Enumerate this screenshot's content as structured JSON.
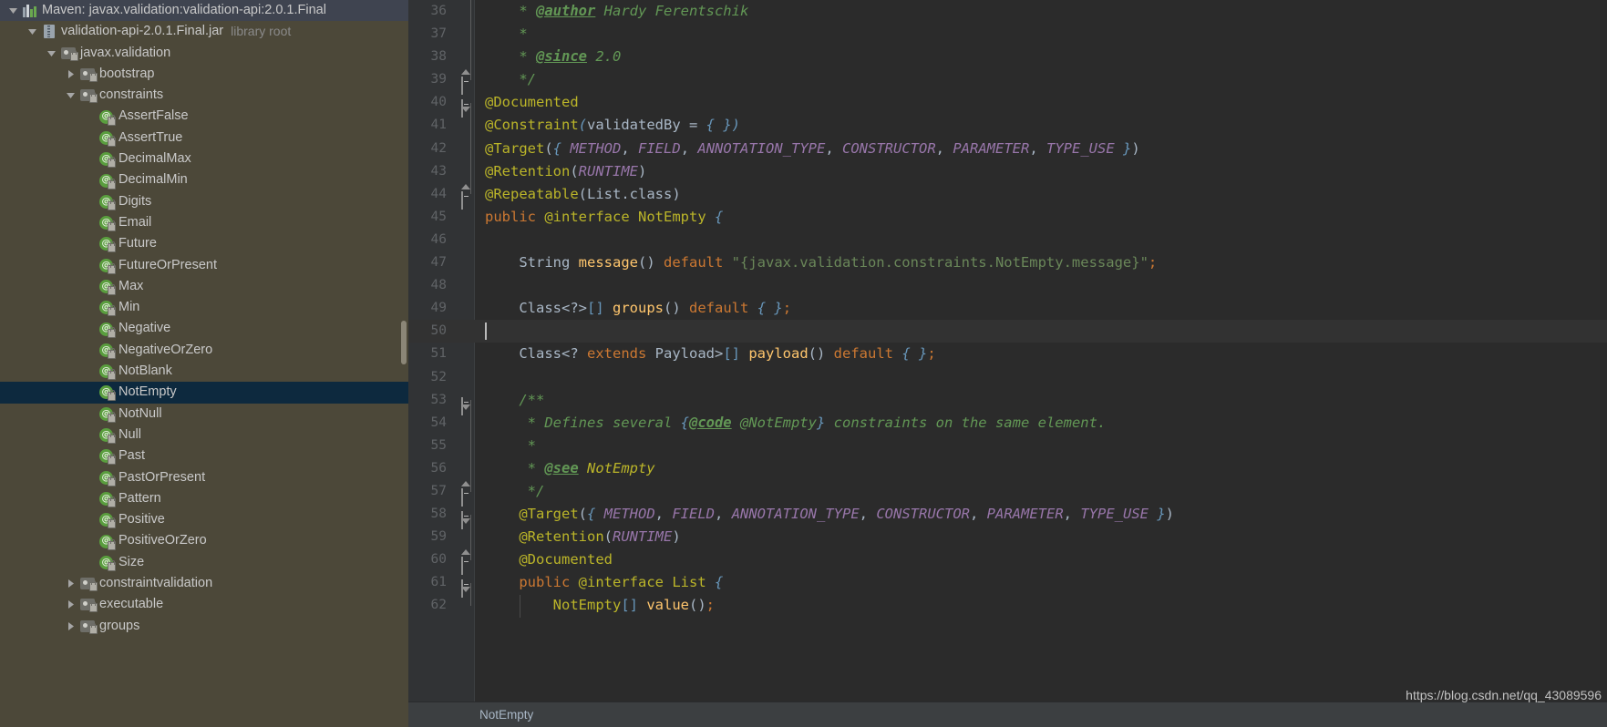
{
  "theme": {
    "tree_bg": "#4c4839",
    "tree_root_bg": "#3f4450",
    "tree_selected_bg": "#0d293e",
    "editor_bg": "#2b2b2b",
    "gutter_bg": "#313335",
    "current_line_bg": "#323232",
    "keyword": "#cc7832",
    "annotation": "#bbb529",
    "method": "#ffc66d",
    "string": "#6a8759",
    "comment": "#629755",
    "static_field": "#9876aa",
    "bracket": "#6897bb",
    "text": "#a9b7c6"
  },
  "project_tree": {
    "name": "project-library-tree",
    "items": [
      {
        "label": "Maven: javax.validation:validation-api:2.0.1.Final",
        "sub": "",
        "depth": 0,
        "icon": "maven-icon",
        "twisty": "expanded",
        "state": "root"
      },
      {
        "label": "validation-api-2.0.1.Final.jar",
        "sub": "library root",
        "depth": 1,
        "icon": "jar-icon",
        "twisty": "expanded",
        "state": "normal"
      },
      {
        "label": "javax.validation",
        "sub": "",
        "depth": 2,
        "icon": "package-icon",
        "twisty": "expanded",
        "state": "normal"
      },
      {
        "label": "bootstrap",
        "sub": "",
        "depth": 3,
        "icon": "package-icon",
        "twisty": "collapsed",
        "state": "normal"
      },
      {
        "label": "constraints",
        "sub": "",
        "depth": 3,
        "icon": "package-icon",
        "twisty": "expanded",
        "state": "normal"
      },
      {
        "label": "AssertFalse",
        "sub": "",
        "depth": 4,
        "icon": "annotation-icon",
        "twisty": "none",
        "state": "normal"
      },
      {
        "label": "AssertTrue",
        "sub": "",
        "depth": 4,
        "icon": "annotation-icon",
        "twisty": "none",
        "state": "normal"
      },
      {
        "label": "DecimalMax",
        "sub": "",
        "depth": 4,
        "icon": "annotation-icon",
        "twisty": "none",
        "state": "normal"
      },
      {
        "label": "DecimalMin",
        "sub": "",
        "depth": 4,
        "icon": "annotation-icon",
        "twisty": "none",
        "state": "normal"
      },
      {
        "label": "Digits",
        "sub": "",
        "depth": 4,
        "icon": "annotation-icon",
        "twisty": "none",
        "state": "normal"
      },
      {
        "label": "Email",
        "sub": "",
        "depth": 4,
        "icon": "annotation-icon",
        "twisty": "none",
        "state": "normal"
      },
      {
        "label": "Future",
        "sub": "",
        "depth": 4,
        "icon": "annotation-icon",
        "twisty": "none",
        "state": "normal"
      },
      {
        "label": "FutureOrPresent",
        "sub": "",
        "depth": 4,
        "icon": "annotation-icon",
        "twisty": "none",
        "state": "normal"
      },
      {
        "label": "Max",
        "sub": "",
        "depth": 4,
        "icon": "annotation-icon",
        "twisty": "none",
        "state": "normal"
      },
      {
        "label": "Min",
        "sub": "",
        "depth": 4,
        "icon": "annotation-icon",
        "twisty": "none",
        "state": "normal"
      },
      {
        "label": "Negative",
        "sub": "",
        "depth": 4,
        "icon": "annotation-icon",
        "twisty": "none",
        "state": "normal"
      },
      {
        "label": "NegativeOrZero",
        "sub": "",
        "depth": 4,
        "icon": "annotation-icon",
        "twisty": "none",
        "state": "normal"
      },
      {
        "label": "NotBlank",
        "sub": "",
        "depth": 4,
        "icon": "annotation-icon",
        "twisty": "none",
        "state": "normal"
      },
      {
        "label": "NotEmpty",
        "sub": "",
        "depth": 4,
        "icon": "annotation-icon",
        "twisty": "none",
        "state": "selected"
      },
      {
        "label": "NotNull",
        "sub": "",
        "depth": 4,
        "icon": "annotation-icon",
        "twisty": "none",
        "state": "normal"
      },
      {
        "label": "Null",
        "sub": "",
        "depth": 4,
        "icon": "annotation-icon",
        "twisty": "none",
        "state": "normal"
      },
      {
        "label": "Past",
        "sub": "",
        "depth": 4,
        "icon": "annotation-icon",
        "twisty": "none",
        "state": "normal"
      },
      {
        "label": "PastOrPresent",
        "sub": "",
        "depth": 4,
        "icon": "annotation-icon",
        "twisty": "none",
        "state": "normal"
      },
      {
        "label": "Pattern",
        "sub": "",
        "depth": 4,
        "icon": "annotation-icon",
        "twisty": "none",
        "state": "normal"
      },
      {
        "label": "Positive",
        "sub": "",
        "depth": 4,
        "icon": "annotation-icon",
        "twisty": "none",
        "state": "normal"
      },
      {
        "label": "PositiveOrZero",
        "sub": "",
        "depth": 4,
        "icon": "annotation-icon",
        "twisty": "none",
        "state": "normal"
      },
      {
        "label": "Size",
        "sub": "",
        "depth": 4,
        "icon": "annotation-icon",
        "twisty": "none",
        "state": "normal"
      },
      {
        "label": "constraintvalidation",
        "sub": "",
        "depth": 3,
        "icon": "package-icon",
        "twisty": "collapsed",
        "state": "normal"
      },
      {
        "label": "executable",
        "sub": "",
        "depth": 3,
        "icon": "package-icon",
        "twisty": "collapsed",
        "state": "normal"
      },
      {
        "label": "groups",
        "sub": "",
        "depth": 3,
        "icon": "package-icon",
        "twisty": "collapsed",
        "state": "normal"
      }
    ]
  },
  "editor": {
    "name": "java-source-editor",
    "first_line_number": 36,
    "current_line": 50,
    "lines": [
      {
        "n": 36,
        "fold": "none",
        "tokens": [
          {
            "t": "cmt",
            "s": "    * "
          },
          {
            "t": "tag",
            "s": "@author"
          },
          {
            "t": "cmt",
            "s": " Hardy Ferentschik"
          }
        ]
      },
      {
        "n": 37,
        "fold": "none",
        "tokens": [
          {
            "t": "cmt",
            "s": "    *"
          }
        ]
      },
      {
        "n": 38,
        "fold": "none",
        "tokens": [
          {
            "t": "cmt",
            "s": "    * "
          },
          {
            "t": "tag",
            "s": "@since"
          },
          {
            "t": "cmt",
            "s": " 2.0"
          }
        ]
      },
      {
        "n": 39,
        "fold": "end",
        "tokens": [
          {
            "t": "cmt",
            "s": "    */"
          }
        ]
      },
      {
        "n": 40,
        "fold": "start",
        "tokens": [
          {
            "t": "anno",
            "s": "@Documented"
          }
        ]
      },
      {
        "n": 41,
        "fold": "none",
        "tokens": [
          {
            "t": "anno",
            "s": "@Constraint"
          },
          {
            "t": "brace-c",
            "s": "("
          },
          {
            "t": "ident",
            "s": "validatedBy"
          },
          {
            "t": "ident",
            "s": " = "
          },
          {
            "t": "brace-c",
            "s": "{ }"
          },
          {
            "t": "brace-c",
            "s": ")"
          }
        ]
      },
      {
        "n": 42,
        "fold": "none",
        "tokens": [
          {
            "t": "anno",
            "s": "@Target"
          },
          {
            "t": "paren",
            "s": "("
          },
          {
            "t": "brace-c",
            "s": "{ "
          },
          {
            "t": "sfield",
            "s": "METHOD"
          },
          {
            "t": "ident",
            "s": ", "
          },
          {
            "t": "sfield",
            "s": "FIELD"
          },
          {
            "t": "ident",
            "s": ", "
          },
          {
            "t": "sfield",
            "s": "ANNOTATION_TYPE"
          },
          {
            "t": "ident",
            "s": ", "
          },
          {
            "t": "sfield",
            "s": "CONSTRUCTOR"
          },
          {
            "t": "ident",
            "s": ", "
          },
          {
            "t": "sfield",
            "s": "PARAMETER"
          },
          {
            "t": "ident",
            "s": ", "
          },
          {
            "t": "sfield",
            "s": "TYPE_USE"
          },
          {
            "t": "brace-c",
            "s": " }"
          },
          {
            "t": "paren",
            "s": ")"
          }
        ]
      },
      {
        "n": 43,
        "fold": "none",
        "tokens": [
          {
            "t": "anno",
            "s": "@Retention"
          },
          {
            "t": "paren",
            "s": "("
          },
          {
            "t": "sfield",
            "s": "RUNTIME"
          },
          {
            "t": "paren",
            "s": ")"
          }
        ]
      },
      {
        "n": 44,
        "fold": "end",
        "tokens": [
          {
            "t": "anno",
            "s": "@Repeatable"
          },
          {
            "t": "paren",
            "s": "("
          },
          {
            "t": "ident",
            "s": "List.class"
          },
          {
            "t": "paren",
            "s": ")"
          }
        ]
      },
      {
        "n": 45,
        "fold": "none",
        "tokens": [
          {
            "t": "kw",
            "s": "public"
          },
          {
            "t": "ident",
            "s": " "
          },
          {
            "t": "anno",
            "s": "@interface"
          },
          {
            "t": "ident",
            "s": " "
          },
          {
            "t": "olive",
            "s": "NotEmpty"
          },
          {
            "t": "ident",
            "s": " "
          },
          {
            "t": "brace-c",
            "s": "{"
          }
        ]
      },
      {
        "n": 46,
        "fold": "none",
        "tokens": []
      },
      {
        "n": 47,
        "fold": "none",
        "tokens": [
          {
            "t": "type",
            "s": "    String "
          },
          {
            "t": "method",
            "s": "message"
          },
          {
            "t": "paren",
            "s": "()"
          },
          {
            "t": "kw",
            "s": " default "
          },
          {
            "t": "str",
            "s": "\"{javax.validation.constraints.NotEmpty.message}\""
          },
          {
            "t": "semi",
            "s": ";"
          }
        ]
      },
      {
        "n": 48,
        "fold": "none",
        "tokens": []
      },
      {
        "n": 49,
        "fold": "none",
        "tokens": [
          {
            "t": "type",
            "s": "    Class"
          },
          {
            "t": "paren",
            "s": "<?>"
          },
          {
            "t": "brk",
            "s": "[]"
          },
          {
            "t": "ident",
            "s": " "
          },
          {
            "t": "method",
            "s": "groups"
          },
          {
            "t": "paren",
            "s": "()"
          },
          {
            "t": "kw",
            "s": " default "
          },
          {
            "t": "brace-c",
            "s": "{ }"
          },
          {
            "t": "semi",
            "s": ";"
          }
        ]
      },
      {
        "n": 50,
        "fold": "none",
        "tokens": []
      },
      {
        "n": 51,
        "fold": "none",
        "tokens": [
          {
            "t": "type",
            "s": "    Class"
          },
          {
            "t": "paren",
            "s": "<? "
          },
          {
            "t": "kw",
            "s": "extends"
          },
          {
            "t": "type",
            "s": " Payload"
          },
          {
            "t": "paren",
            "s": ">"
          },
          {
            "t": "brk",
            "s": "[]"
          },
          {
            "t": "ident",
            "s": " "
          },
          {
            "t": "method",
            "s": "payload"
          },
          {
            "t": "paren",
            "s": "()"
          },
          {
            "t": "kw",
            "s": " default "
          },
          {
            "t": "brace-c",
            "s": "{ }"
          },
          {
            "t": "semi",
            "s": ";"
          }
        ]
      },
      {
        "n": 52,
        "fold": "none",
        "tokens": []
      },
      {
        "n": 53,
        "fold": "start",
        "tokens": [
          {
            "t": "cmt",
            "s": "    /**"
          }
        ]
      },
      {
        "n": 54,
        "fold": "none",
        "tokens": [
          {
            "t": "cmt",
            "s": "     * Defines several "
          },
          {
            "t": "brace-c",
            "s": "{"
          },
          {
            "t": "codetag",
            "s": "@code"
          },
          {
            "t": "cmt",
            "s": " @NotEmpty"
          },
          {
            "t": "brace-c",
            "s": "}"
          },
          {
            "t": "cmt",
            "s": " constraints on the same element."
          }
        ]
      },
      {
        "n": 55,
        "fold": "none",
        "tokens": [
          {
            "t": "cmt",
            "s": "     *"
          }
        ]
      },
      {
        "n": 56,
        "fold": "none",
        "tokens": [
          {
            "t": "cmt",
            "s": "     * "
          },
          {
            "t": "tag",
            "s": "@see"
          },
          {
            "t": "javadoc-ref",
            "s": " NotEmpty"
          }
        ]
      },
      {
        "n": 57,
        "fold": "end",
        "tokens": [
          {
            "t": "cmt",
            "s": "     */"
          }
        ]
      },
      {
        "n": 58,
        "fold": "start",
        "tokens": [
          {
            "t": "anno",
            "s": "    @Target"
          },
          {
            "t": "paren",
            "s": "("
          },
          {
            "t": "brace-c",
            "s": "{ "
          },
          {
            "t": "sfield",
            "s": "METHOD"
          },
          {
            "t": "ident",
            "s": ", "
          },
          {
            "t": "sfield",
            "s": "FIELD"
          },
          {
            "t": "ident",
            "s": ", "
          },
          {
            "t": "sfield",
            "s": "ANNOTATION_TYPE"
          },
          {
            "t": "ident",
            "s": ", "
          },
          {
            "t": "sfield",
            "s": "CONSTRUCTOR"
          },
          {
            "t": "ident",
            "s": ", "
          },
          {
            "t": "sfield",
            "s": "PARAMETER"
          },
          {
            "t": "ident",
            "s": ", "
          },
          {
            "t": "sfield",
            "s": "TYPE_USE"
          },
          {
            "t": "brace-c",
            "s": " }"
          },
          {
            "t": "paren",
            "s": ")"
          }
        ]
      },
      {
        "n": 59,
        "fold": "none",
        "tokens": [
          {
            "t": "anno",
            "s": "    @Retention"
          },
          {
            "t": "paren",
            "s": "("
          },
          {
            "t": "sfield",
            "s": "RUNTIME"
          },
          {
            "t": "paren",
            "s": ")"
          }
        ]
      },
      {
        "n": 60,
        "fold": "end",
        "tokens": [
          {
            "t": "anno",
            "s": "    @Documented"
          }
        ]
      },
      {
        "n": 61,
        "fold": "start",
        "tokens": [
          {
            "t": "kw",
            "s": "    public"
          },
          {
            "t": "ident",
            "s": " "
          },
          {
            "t": "anno",
            "s": "@interface"
          },
          {
            "t": "ident",
            "s": " "
          },
          {
            "t": "olive",
            "s": "List"
          },
          {
            "t": "ident",
            "s": " "
          },
          {
            "t": "brace-c",
            "s": "{"
          }
        ]
      },
      {
        "n": 62,
        "fold": "none",
        "tokens": [
          {
            "t": "olive",
            "s": "        NotEmpty"
          },
          {
            "t": "brk",
            "s": "[]"
          },
          {
            "t": "ident",
            "s": " "
          },
          {
            "t": "method",
            "s": "value"
          },
          {
            "t": "paren",
            "s": "()"
          },
          {
            "t": "semi",
            "s": ";"
          }
        ]
      }
    ]
  },
  "breadcrumb": {
    "name": "editor-breadcrumb",
    "text": "NotEmpty"
  },
  "watermark": {
    "name": "blog-watermark",
    "text": "https://blog.csdn.net/qq_43089596"
  }
}
